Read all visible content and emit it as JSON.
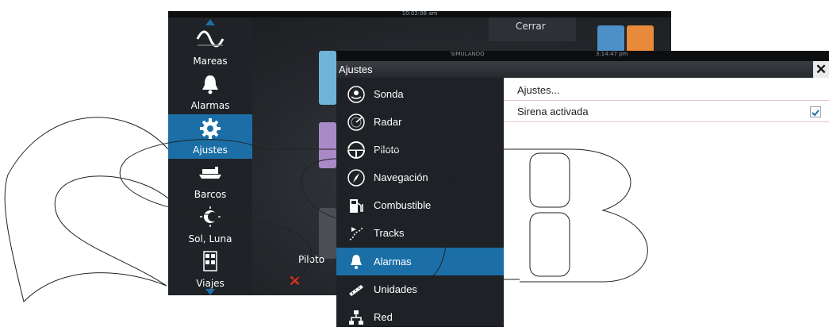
{
  "background_window": {
    "clock": "10:02:06 am",
    "close_label": "Cerrar",
    "left_menu": [
      {
        "label": "Mareas",
        "icon": "tide-wave-icon"
      },
      {
        "label": "Alarmas",
        "icon": "bell-icon"
      },
      {
        "label": "Ajustes",
        "icon": "gear-icon"
      },
      {
        "label": "Barcos",
        "icon": "ship-icon"
      },
      {
        "label": "Sol, Luna",
        "icon": "sun-moon-icon"
      },
      {
        "label": "Viajes",
        "icon": "calculator-icon"
      }
    ],
    "active_item": "Ajustes",
    "piloto_label": "Piloto"
  },
  "dialog": {
    "status_left": "SIMULANDO",
    "status_right": "3:14:47 pm",
    "title": "Ajustes",
    "menu": [
      {
        "label": "Sonda",
        "icon": "sonar-icon"
      },
      {
        "label": "Radar",
        "icon": "radar-icon"
      },
      {
        "label": "Piloto",
        "icon": "steering-wheel-icon"
      },
      {
        "label": "Navegación",
        "icon": "compass-icon"
      },
      {
        "label": "Combustible",
        "icon": "fuel-pump-icon"
      },
      {
        "label": "Tracks",
        "icon": "track-icon"
      },
      {
        "label": "Alarmas",
        "icon": "bell-icon"
      },
      {
        "label": "Unidades",
        "icon": "ruler-icon"
      },
      {
        "label": "Red",
        "icon": "network-icon"
      }
    ],
    "active_item": "Alarmas",
    "panel": {
      "row1": "Ajustes...",
      "row2": "Sirena activada",
      "row2_checked": true
    }
  },
  "colors": {
    "accent": "#1b6fa6",
    "menu_bg": "#1e2125"
  }
}
